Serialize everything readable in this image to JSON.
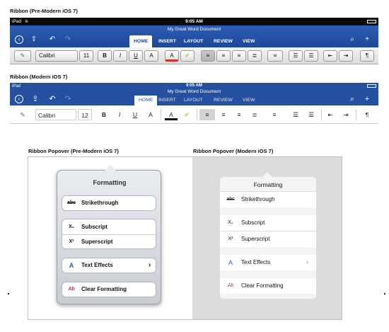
{
  "labels": {
    "ribbon_pre": "Ribbon (Pre-Modern iOS 7)",
    "ribbon_modern": "Ribbon (Modern iOS 7)",
    "popover_pre": "Ribbon Popover (Pre-Modern iOS 7)",
    "popover_modern": "Ribbon Popover (Modern iOS 7)"
  },
  "ribbon_pre": {
    "carrier": "iPad",
    "time": "9:05 AM",
    "doc_title": "My Great Word Document",
    "tabs": [
      "HOME",
      "INSERT",
      "LAYOUT",
      "REVIEW",
      "VIEW"
    ],
    "active_tab": "HOME",
    "font": "Calibri",
    "font_size": "11",
    "bold": "B",
    "italic": "I",
    "underline": "U",
    "subscript": "A",
    "font_color": "A"
  },
  "ribbon_modern": {
    "carrier": "iPad",
    "time": "9:05 AM",
    "doc_title": "My Great Word Document",
    "tabs": [
      "HOME",
      "INSERT",
      "LAYOUT",
      "REVIEW",
      "VIEW"
    ],
    "active_tab": "HOME",
    "font": "Calibri",
    "font_size": "12",
    "bold": "B",
    "italic": "I",
    "underline": "U",
    "subscript": "A",
    "font_color": "A"
  },
  "popover_pre": {
    "title": "Formatting",
    "items": {
      "strikethrough": {
        "icon": "abc",
        "label": "Strikethrough"
      },
      "subscript": {
        "icon": "X₂",
        "label": "Subscript"
      },
      "superscript": {
        "icon": "X²",
        "label": "Superscript"
      },
      "text_effects": {
        "icon": "A",
        "label": "Text Effects",
        "chevron": "›"
      },
      "clear_formatting": {
        "icon": "Ab",
        "label": "Clear Formatting"
      }
    }
  },
  "popover_modern": {
    "title": "Formatting",
    "items": {
      "strikethrough": {
        "icon": "abc",
        "label": "Strikethrough"
      },
      "subscript": {
        "icon": "X₂",
        "label": "Subscript"
      },
      "superscript": {
        "icon": "X²",
        "label": "Superscript"
      },
      "text_effects": {
        "icon": "A",
        "label": "Text Effects",
        "chevron": "›"
      },
      "clear_formatting": {
        "icon": "Ab",
        "label": "Clear Formatting"
      }
    }
  },
  "colors": {
    "ribbon_pre_blue": "#1e4898",
    "ribbon_modern_blue": "#24509f",
    "highlight_yellow": "#f2d200",
    "font_color_red": "#d32f2f"
  },
  "icons": {
    "nav": [
      "back-icon",
      "save-icon",
      "undo-icon",
      "redo-icon"
    ],
    "right": [
      "search-icon",
      "share-user-icon"
    ],
    "styles": "styles-pen-icon",
    "highlight": "highlighter-icon",
    "paragraph": "pilcrow-icon"
  }
}
